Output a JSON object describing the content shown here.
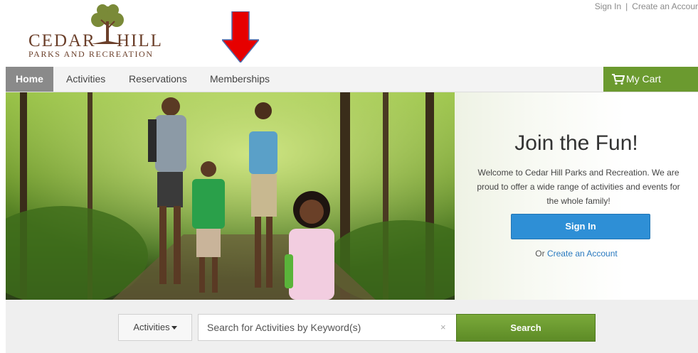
{
  "header": {
    "sign_in_link": "Sign In",
    "separator": "|",
    "create_account_link": "Create an Accour"
  },
  "logo": {
    "word_left": "CEDAR",
    "word_right": "HILL",
    "subtitle": "PARKS AND RECREATION",
    "icon": "tree-icon"
  },
  "nav": {
    "items": [
      "Home",
      "Activities",
      "Reservations",
      "Memberships"
    ],
    "active": "Home",
    "cart_label": "My Cart",
    "cart_icon": "shopping-cart-icon"
  },
  "annotation": {
    "icon": "down-arrow-icon",
    "color": "#e60000"
  },
  "hero": {
    "title": "Join the Fun!",
    "text": "Welcome to Cedar Hill Parks and Recreation. We are proud to offer a wide range of activities and events for the whole family!",
    "signin_button": "Sign In",
    "or_text": "Or",
    "create_account_link": "Create an Account"
  },
  "search": {
    "category": "Activities",
    "placeholder": "Search for Activities by Keyword(s)",
    "clear_icon": "×",
    "button": "Search"
  },
  "colors": {
    "accent_green": "#6b9a2f",
    "signin_blue": "#2e8fd6",
    "nav_active_bg": "#8a8a8a",
    "logo_brown": "#6b3f2a"
  }
}
